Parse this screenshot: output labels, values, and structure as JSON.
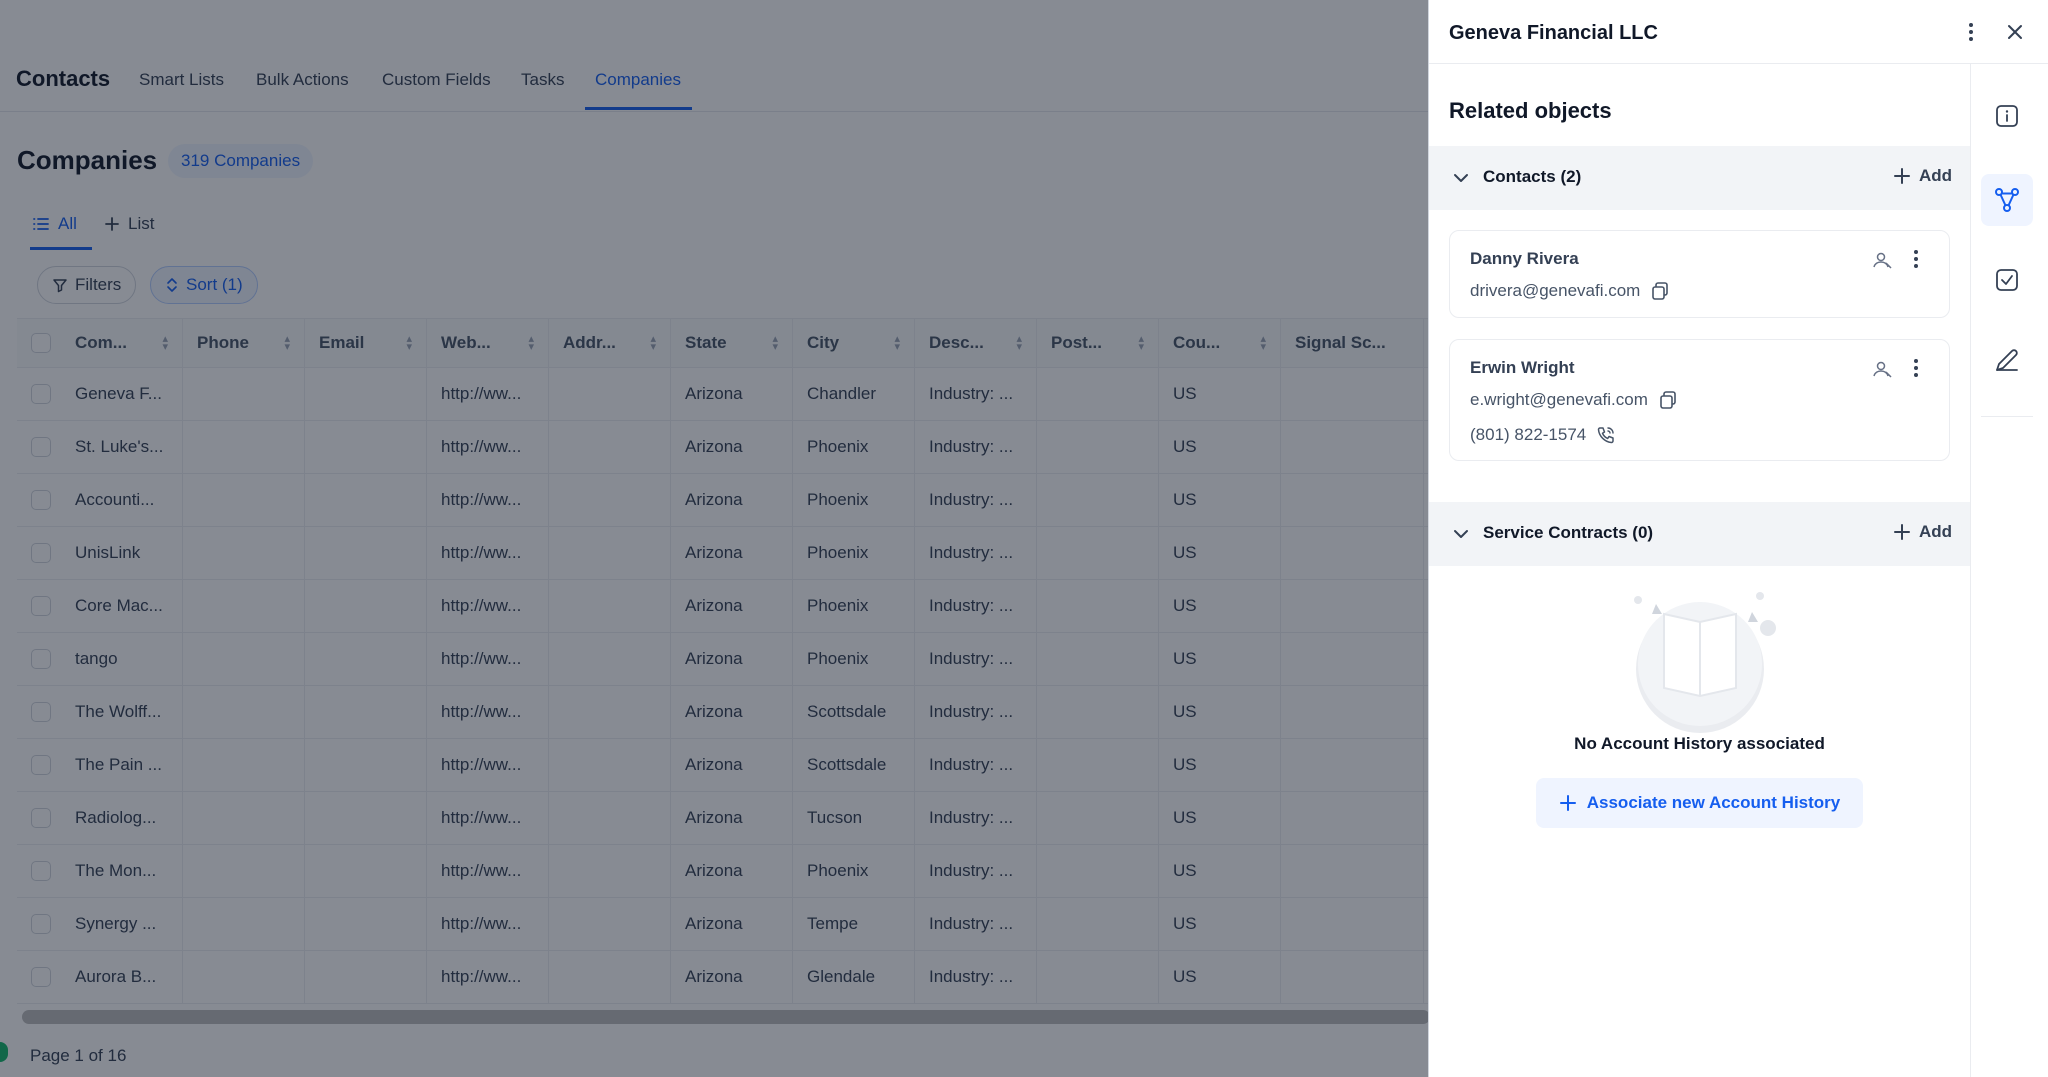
{
  "app": {
    "brand": "Contacts",
    "tabs": [
      "Smart Lists",
      "Bulk Actions",
      "Custom Fields",
      "Tasks",
      "Companies"
    ],
    "active_tab": "Companies"
  },
  "page": {
    "title": "Companies",
    "count_badge": "319 Companies",
    "view_tabs": {
      "all": "All",
      "list": "List"
    },
    "filters_label": "Filters",
    "sort_label": "Sort (1)",
    "pager": "Page 1 of 16"
  },
  "table": {
    "headers": [
      "Com...",
      "Phone",
      "Email",
      "Web...",
      "Addr...",
      "State",
      "City",
      "Desc...",
      "Post...",
      "Cou...",
      "Signal Sc..."
    ],
    "rows": [
      [
        "Geneva F...",
        "",
        "",
        "http://ww...",
        "",
        "Arizona",
        "Chandler",
        "Industry: ...",
        "",
        "US",
        ""
      ],
      [
        "St. Luke's...",
        "",
        "",
        "http://ww...",
        "",
        "Arizona",
        "Phoenix",
        "Industry: ...",
        "",
        "US",
        ""
      ],
      [
        "Accounti...",
        "",
        "",
        "http://ww...",
        "",
        "Arizona",
        "Phoenix",
        "Industry: ...",
        "",
        "US",
        ""
      ],
      [
        "UnisLink",
        "",
        "",
        "http://ww...",
        "",
        "Arizona",
        "Phoenix",
        "Industry: ...",
        "",
        "US",
        ""
      ],
      [
        "Core Mac...",
        "",
        "",
        "http://ww...",
        "",
        "Arizona",
        "Phoenix",
        "Industry: ...",
        "",
        "US",
        ""
      ],
      [
        "tango",
        "",
        "",
        "http://ww...",
        "",
        "Arizona",
        "Phoenix",
        "Industry: ...",
        "",
        "US",
        ""
      ],
      [
        "The Wolff...",
        "",
        "",
        "http://ww...",
        "",
        "Arizona",
        "Scottsdale",
        "Industry: ...",
        "",
        "US",
        ""
      ],
      [
        "The Pain ...",
        "",
        "",
        "http://ww...",
        "",
        "Arizona",
        "Scottsdale",
        "Industry: ...",
        "",
        "US",
        ""
      ],
      [
        "Radiolog...",
        "",
        "",
        "http://ww...",
        "",
        "Arizona",
        "Tucson",
        "Industry: ...",
        "",
        "US",
        ""
      ],
      [
        "The Mon...",
        "",
        "",
        "http://ww...",
        "",
        "Arizona",
        "Phoenix",
        "Industry: ...",
        "",
        "US",
        ""
      ],
      [
        "Synergy ...",
        "",
        "",
        "http://ww...",
        "",
        "Arizona",
        "Tempe",
        "Industry: ...",
        "",
        "US",
        ""
      ],
      [
        "Aurora B...",
        "",
        "",
        "http://ww...",
        "",
        "Arizona",
        "Glendale",
        "Industry: ...",
        "",
        "US",
        ""
      ]
    ]
  },
  "drawer": {
    "title": "Geneva Financial LLC",
    "section_title": "Related objects",
    "contacts_section": {
      "label": "Contacts (2)",
      "add_label": "Add"
    },
    "contacts": [
      {
        "name": "Danny Rivera",
        "email": "drivera@genevafi.com",
        "phone": ""
      },
      {
        "name": "Erwin Wright",
        "email": "e.wright@genevafi.com",
        "phone": "(801) 822-1574"
      }
    ],
    "service_section": {
      "label": "Service Contracts (0)",
      "add_label": "Add"
    },
    "empty_text": "No Account History associated",
    "associate_button": "Associate new Account History"
  },
  "colors": {
    "accent": "#155eef",
    "accent_bg": "#eff4ff",
    "overlay": "rgba(16,24,40,0.5)"
  },
  "icons": [
    "list-icon",
    "plus-icon",
    "filter-icon",
    "sort-icon",
    "kebab-icon",
    "close-icon",
    "info-icon",
    "related-objects-icon",
    "task-check-icon",
    "pen-icon",
    "chevron-down-icon",
    "person-icon",
    "copy-icon",
    "phone-icon"
  ]
}
